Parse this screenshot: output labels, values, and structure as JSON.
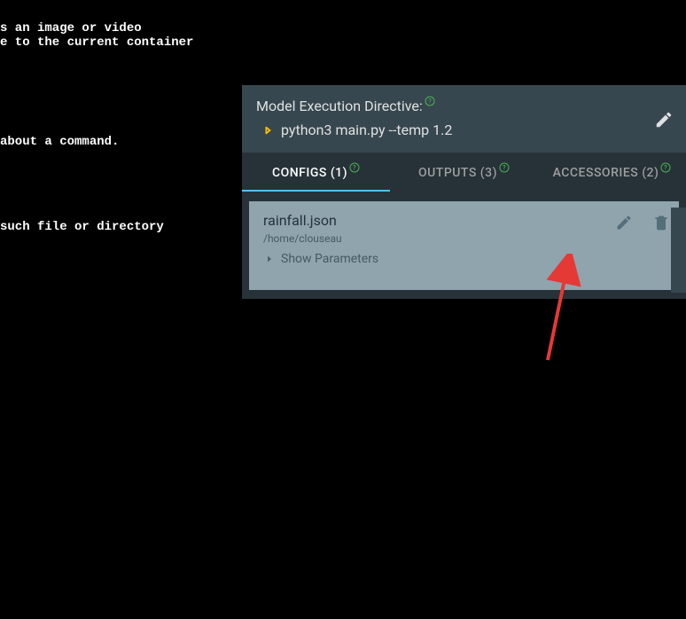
{
  "terminal": {
    "line1": "s an image or video",
    "line2": "e to the current container",
    "line3": "about a command.",
    "line4": "such file or directory"
  },
  "directive": {
    "label": "Model Execution Directive:",
    "command": "python3 main.py --temp 1.2"
  },
  "tabs": [
    {
      "label": "CONFIGS (1)",
      "active": true
    },
    {
      "label": "OUTPUTS (3)",
      "active": false
    },
    {
      "label": "ACCESSORIES (2)",
      "active": false
    }
  ],
  "config_card": {
    "title": "rainfall.json",
    "path": "/home/clouseau",
    "show_params": "Show Parameters"
  }
}
